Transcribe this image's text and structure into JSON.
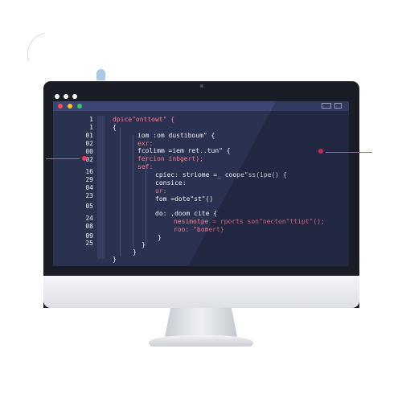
{
  "screen": {
    "line_numbers": [
      "1",
      "1",
      "01",
      "02",
      "00",
      "02",
      "16",
      "29",
      "04",
      "23",
      "05",
      "24",
      "08",
      "09",
      "25"
    ],
    "code_lines": [
      "dpice\"onttowt\" {",
      "{",
      "iom :om dustiboum\" {",
      "exr:",
      "fcolimm =iem ret..tun\" {",
      "fercion inbgert);",
      "sef:",
      "cpiec: striome =_ coope\"ss(ipe() {",
      "consice:",
      "ur:",
      "fom =dote\"st\"()",
      "do: ,doom cite {",
      "nesimotpe = rports son\"necton\"ttipt\"();",
      "roo: \"bomert}",
      "}",
      "}",
      "}",
      "}"
    ]
  },
  "colors": {
    "screen_bg": "#2b3150",
    "titlebar": "#3c4676",
    "accent_red": "#ee3b56",
    "code_text": "#f2f3f8"
  }
}
